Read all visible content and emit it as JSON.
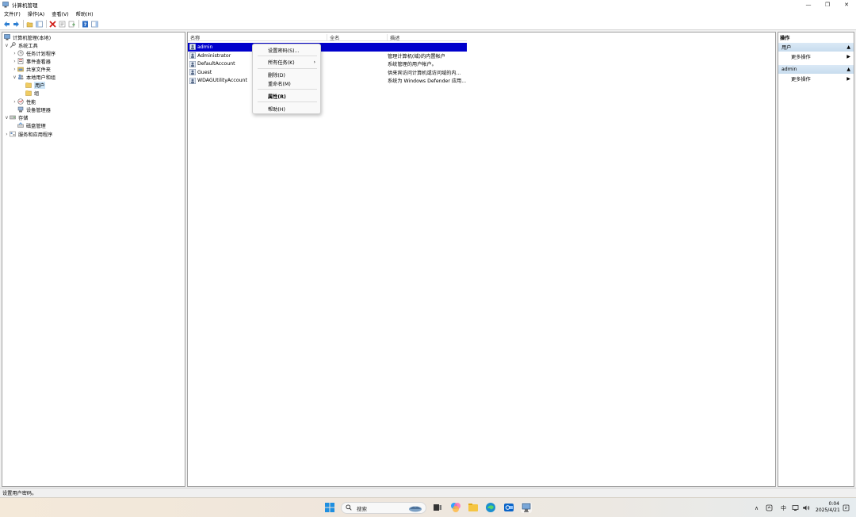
{
  "window": {
    "title": "计算机管理",
    "minimize": "—",
    "restore": "❐",
    "close": "✕"
  },
  "menubar": {
    "items": [
      "文件(F)",
      "操作(A)",
      "查看(V)",
      "帮助(H)"
    ]
  },
  "tree": {
    "root": "计算机管理(本地)",
    "system_tools": "系统工具",
    "task_scheduler": "任务计划程序",
    "event_viewer": "事件查看器",
    "shared_folders": "共享文件夹",
    "local_users_groups": "本地用户和组",
    "users": "用户",
    "groups": "组",
    "performance": "性能",
    "device_manager": "设备管理器",
    "storage": "存储",
    "disk_management": "磁盘管理",
    "services_apps": "服务和应用程序"
  },
  "list": {
    "headers": [
      "名称",
      "全名",
      "描述"
    ],
    "rows": [
      {
        "name": "admin",
        "fullname": "",
        "desc": ""
      },
      {
        "name": "Administrator",
        "fullname": "",
        "desc": "管理计算机(域)的内置帐户"
      },
      {
        "name": "DefaultAccount",
        "fullname": "",
        "desc": "系统管理的用户帐户。"
      },
      {
        "name": "Guest",
        "fullname": "",
        "desc": "供来宾访问计算机或访问域的内..."
      },
      {
        "name": "WDAGUtilityAccount",
        "fullname": "",
        "desc": "系统为 Windows Defender 应用..."
      }
    ]
  },
  "context_menu": {
    "set_password": "设置密码(S)...",
    "all_tasks": "所有任务(K)",
    "delete": "删除(D)",
    "rename": "重命名(M)",
    "properties": "属性(R)",
    "help": "帮助(H)"
  },
  "actions": {
    "title": "操作",
    "section_users": "用户",
    "more_actions_1": "更多操作",
    "section_admin": "admin",
    "more_actions_2": "更多操作"
  },
  "status": {
    "text": "设置用户密码。"
  },
  "taskbar": {
    "search_placeholder": "搜索",
    "ime": "中",
    "time": "0:04",
    "date": "2025/4/21"
  },
  "colors": {
    "selection": "#0000cc",
    "tree_selection": "#cce4f7"
  }
}
